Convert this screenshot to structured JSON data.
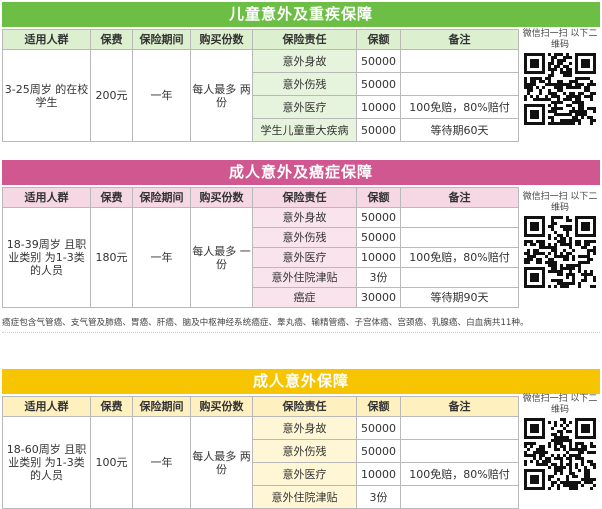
{
  "children": {
    "title": "儿童意外及重疾保障",
    "headers": [
      "适用人群",
      "保费",
      "保险期间",
      "购买份数",
      "保险责任",
      "保额",
      "备注"
    ],
    "group": "3-25周岁 的在校学生",
    "premium": "200元",
    "period": "一年",
    "purchase": "每人最多 两份",
    "rows": [
      {
        "item": "意外身故",
        "amount": "50000",
        "remark": ""
      },
      {
        "item": "意外伤残",
        "amount": "50000",
        "remark": ""
      },
      {
        "item": "意外医疗",
        "amount": "10000",
        "remark": "100免赔，80%赔付"
      },
      {
        "item": "学生儿童重大疾病",
        "amount": "50000",
        "remark": "等待期60天"
      }
    ],
    "qr_caption": "微信扫一扫 以下二维码"
  },
  "adult_cancer": {
    "title": "成人意外及癌症保障",
    "headers": [
      "适用人群",
      "保费",
      "保险期间",
      "购买份数",
      "保险责任",
      "保额",
      "备注"
    ],
    "group": "18-39周岁 且职业类别 为1-3类的人员",
    "premium": "180元",
    "period": "一年",
    "purchase": "每人最多 一份",
    "rows": [
      {
        "item": "意外身故",
        "amount": "50000",
        "remark": ""
      },
      {
        "item": "意外伤残",
        "amount": "50000",
        "remark": ""
      },
      {
        "item": "意外医疗",
        "amount": "10000",
        "remark": "100免赔，80%赔付"
      },
      {
        "item": "意外住院津贴",
        "amount": "3份",
        "remark": ""
      },
      {
        "item": "癌症",
        "amount": "30000",
        "remark": "等待期90天"
      }
    ],
    "qr_caption": "微信扫一扫 以下二维码",
    "note": "癌症包含气管癌、支气管及肺癌、胃癌、肝癌、脑及中枢神经系统癌症、睾丸癌、输精管癌、子宫体癌、宫颈癌、乳腺癌、白血病共11种。"
  },
  "adult": {
    "title": "成人意外保障",
    "headers": [
      "适用人群",
      "保费",
      "保险期间",
      "购买份数",
      "保险责任",
      "保额",
      "备注"
    ],
    "group": "18-60周岁 且职业类别 为1-3类的人员",
    "premium": "100元",
    "period": "一年",
    "purchase": "每人最多 两份",
    "rows": [
      {
        "item": "意外身故",
        "amount": "50000",
        "remark": ""
      },
      {
        "item": "意外伤残",
        "amount": "50000",
        "remark": ""
      },
      {
        "item": "意外医疗",
        "amount": "10000",
        "remark": "100免赔，80%赔付"
      },
      {
        "item": "意外住院津贴",
        "amount": "3份",
        "remark": ""
      }
    ],
    "qr_caption": "微信扫一扫 以下二维码"
  },
  "colors": {
    "children_accent": "#6cbe45",
    "adult_cancer_accent": "#d0578f",
    "adult_accent": "#f6c400"
  }
}
